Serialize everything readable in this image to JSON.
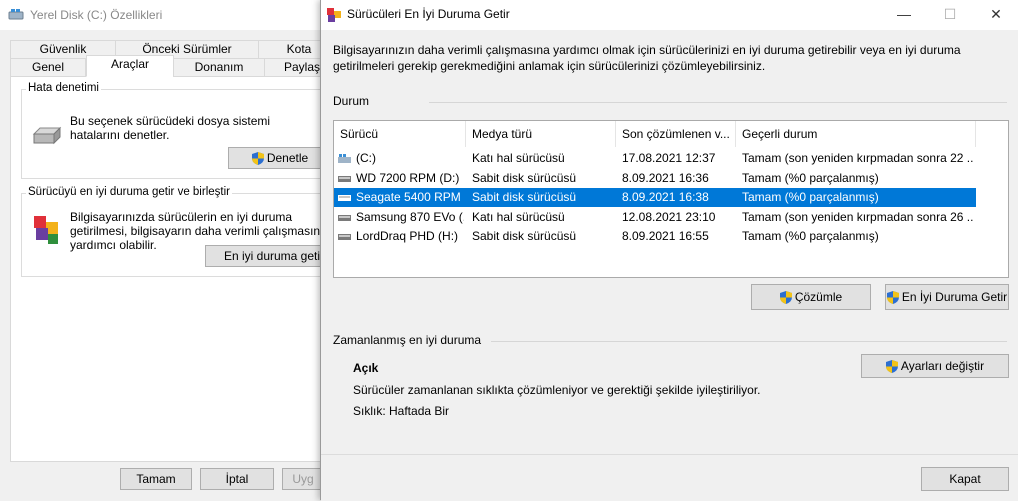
{
  "back_window": {
    "title": "Yerel Disk (C:) Özellikleri",
    "tabs_row1": [
      "Güvenlik",
      "Önceki Sürümler",
      "Kota"
    ],
    "tabs_row2": [
      "Genel",
      "Araçlar",
      "Donanım",
      "Paylaş"
    ],
    "selected_tab": "Araçlar",
    "error_check": {
      "title": "Hata denetimi",
      "text": "Bu seçenek sürücüdeki dosya sistemi hatalarını denetler.",
      "button": "Denetle"
    },
    "optimize": {
      "title": "Sürücüyü en iyi duruma getir ve birleştir",
      "text": "Bilgisayarınızda sürücülerin en iyi duruma getirilmesi, bilgisayarın daha verimli çalışmasına yardımcı olabilir.",
      "button": "En iyi duruma getir"
    },
    "footer": {
      "ok": "Tamam",
      "cancel": "İptal",
      "apply": "Uyg"
    }
  },
  "front_window": {
    "title": "Sürücüleri En İyi Duruma Getir",
    "controls": {
      "minimize": "—",
      "maximize": "☐",
      "close": "✕"
    },
    "description": "Bilgisayarınızın daha verimli çalışmasına yardımcı olmak için sürücülerinizi en iyi duruma getirebilir veya en iyi duruma getirilmeleri gerekip gerekmediğini anlamak için sürücülerinizi çözümleyebilirsiniz.",
    "status_label": "Durum",
    "columns": [
      "Sürücü",
      "Medya türü",
      "Son çözümlenen v...",
      "Geçerli durum"
    ],
    "drives": [
      {
        "name": "(C:)",
        "media": "Katı hal sürücüsü",
        "last": "17.08.2021 12:37",
        "status": "Tamam (son yeniden kırpmadan sonra 22 ...",
        "selected": false
      },
      {
        "name": "WD 7200 RPM (D:)",
        "media": "Sabit disk sürücüsü",
        "last": "8.09.2021 16:36",
        "status": "Tamam (%0 parçalanmış)",
        "selected": false
      },
      {
        "name": "Seagate 5400 RPM ...",
        "media": "Sabit disk sürücüsü",
        "last": "8.09.2021 16:38",
        "status": "Tamam (%0 parçalanmış)",
        "selected": true
      },
      {
        "name": "Samsung 870 EVo (...",
        "media": "Katı hal sürücüsü",
        "last": "12.08.2021 23:10",
        "status": "Tamam (son yeniden kırpmadan sonra 26 ...",
        "selected": false
      },
      {
        "name": "LordDraq PHD (H:)",
        "media": "Sabit disk sürücüsü",
        "last": "8.09.2021 16:55",
        "status": "Tamam (%0 parçalanmış)",
        "selected": false
      }
    ],
    "analyze_button": "Çözümle",
    "optimize_button": "En İyi Duruma Getir",
    "scheduled_label": "Zamanlanmış en iyi duruma",
    "scheduled_state": "Açık",
    "scheduled_text": "Sürücüler zamanlanan sıklıkta çözümleniyor ve gerektiği şekilde iyileştiriliyor.",
    "frequency": "Sıklık: Haftada Bir",
    "settings_button": "Ayarları değiştir",
    "close_button": "Kapat"
  },
  "colors": {
    "accent": "#0078d7",
    "selection": "#0078d7"
  }
}
